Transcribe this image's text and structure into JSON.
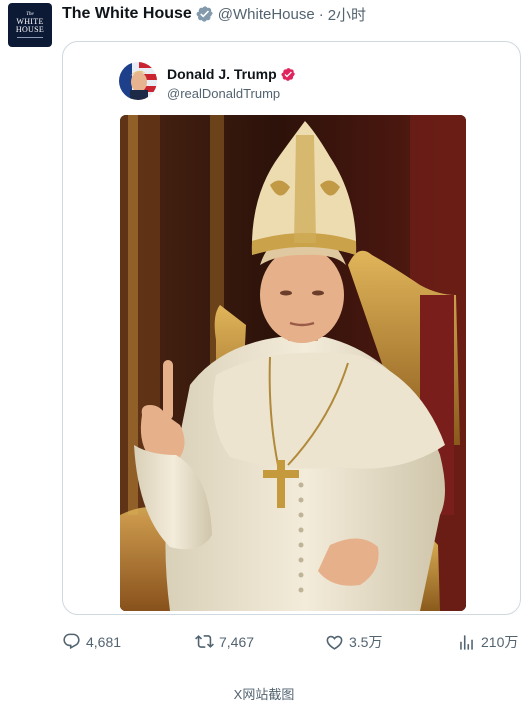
{
  "post": {
    "author": {
      "name": "The White House",
      "handle": "@WhiteHouse",
      "separator": "·",
      "time": "2小时",
      "avatar": {
        "line1": "The",
        "line2": "WHITE",
        "line3": "HOUSE"
      },
      "verified_icon": "gray-verified-badge-icon"
    },
    "quoted": {
      "author_name": "Donald J. Trump",
      "handle": "@realDonaldTrump",
      "verified_icon": "red-verified-badge-icon",
      "image_icon": "pope-portrait-image"
    },
    "actions": {
      "replies": "4,681",
      "reposts": "7,467",
      "likes": "3.5万",
      "views": "210万"
    }
  },
  "caption": "X网站截图",
  "colors": {
    "text_primary": "#0f1419",
    "text_secondary": "#536471",
    "border": "#cfd9de",
    "gray_badge": "#829aab",
    "red_badge": "#e0245e",
    "avatar_bg": "#0c1a36"
  }
}
